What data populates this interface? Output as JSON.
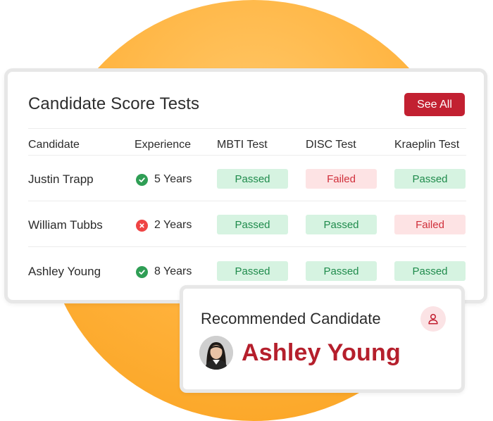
{
  "card": {
    "title": "Candidate Score Tests",
    "see_all_label": "See All",
    "headers": [
      "Candidate",
      "Experience",
      "MBTI Test",
      "DISC Test",
      "Kraeplin Test"
    ],
    "rows": [
      {
        "name": "Justin Trapp",
        "experience": "5 Years",
        "experience_status": "check-icon",
        "mbti": "Passed",
        "disc": "Failed",
        "kraeplin": "Passed"
      },
      {
        "name": "William Tubbs",
        "experience": "2 Years",
        "experience_status": "x-icon",
        "mbti": "Passed",
        "disc": "Passed",
        "kraeplin": "Failed"
      },
      {
        "name": "Ashley Young",
        "experience": "8 Years",
        "experience_status": "check-icon",
        "mbti": "Passed",
        "disc": "Passed",
        "kraeplin": "Passed"
      }
    ]
  },
  "recommended": {
    "title": "Recommended Candidate",
    "name": "Ashley Young",
    "icon": "user-icon"
  },
  "colors": {
    "accent": "#c22031",
    "pass_bg": "#d6f3e1",
    "pass_text": "#1f8b4c",
    "fail_bg": "#fde3e4",
    "fail_text": "#d02f3a",
    "circle": "#ffb13a"
  }
}
